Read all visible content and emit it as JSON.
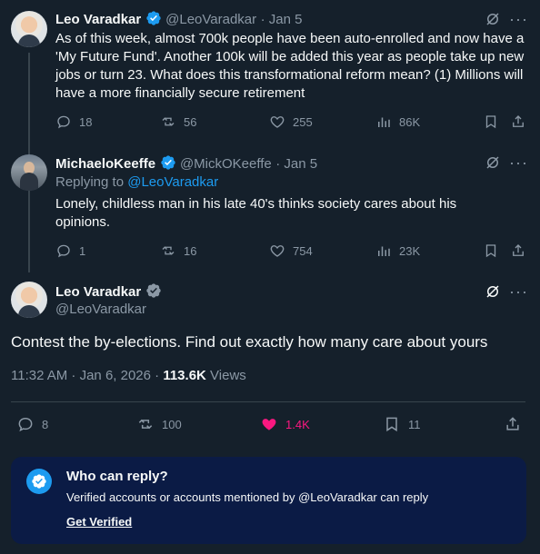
{
  "tweet1": {
    "name": "Leo Varadkar",
    "handle": "@LeoVaradkar",
    "date": "· Jan 5",
    "text": "As of this week, almost 700k people have been auto-enrolled and now have a 'My Future Fund'. Another 100k will be added this year as people take up new jobs or turn 23. What does this transformational reform mean? (1) Millions will have a more financially secure retirement",
    "replies": "18",
    "reposts": "56",
    "likes": "255",
    "views": "86K"
  },
  "tweet2": {
    "name": "MichaeloKeeffe",
    "handle": "@MickOKeeffe",
    "date": "· Jan 5",
    "replying_prefix": "Replying to",
    "replying_to": "@LeoVaradkar",
    "text": "Lonely, childless man in his late 40's thinks society cares about his opinions.",
    "replies": "1",
    "reposts": "16",
    "likes": "754",
    "views": "23K"
  },
  "main": {
    "name": "Leo Varadkar",
    "handle": "@LeoVaradkar",
    "text": "Contest the by-elections. Find out exactly how many care about yours",
    "time": "11:32 AM · Jan 6, 2026 ·",
    "views_count": "113.6K",
    "views_label": "Views",
    "replies": "8",
    "reposts": "100",
    "likes": "1.4K",
    "bookmarks": "11"
  },
  "reply_restriction": {
    "title": "Who can reply?",
    "desc": "Verified accounts or accounts mentioned by @LeoVaradkar can reply",
    "cta": "Get Verified"
  },
  "colors": {
    "bg": "#15202b",
    "text": "#f7f9f9",
    "muted": "#8b98a5",
    "accent": "#1d9bf0",
    "like_active": "#f91880",
    "reply_box": "#0b1b45"
  }
}
